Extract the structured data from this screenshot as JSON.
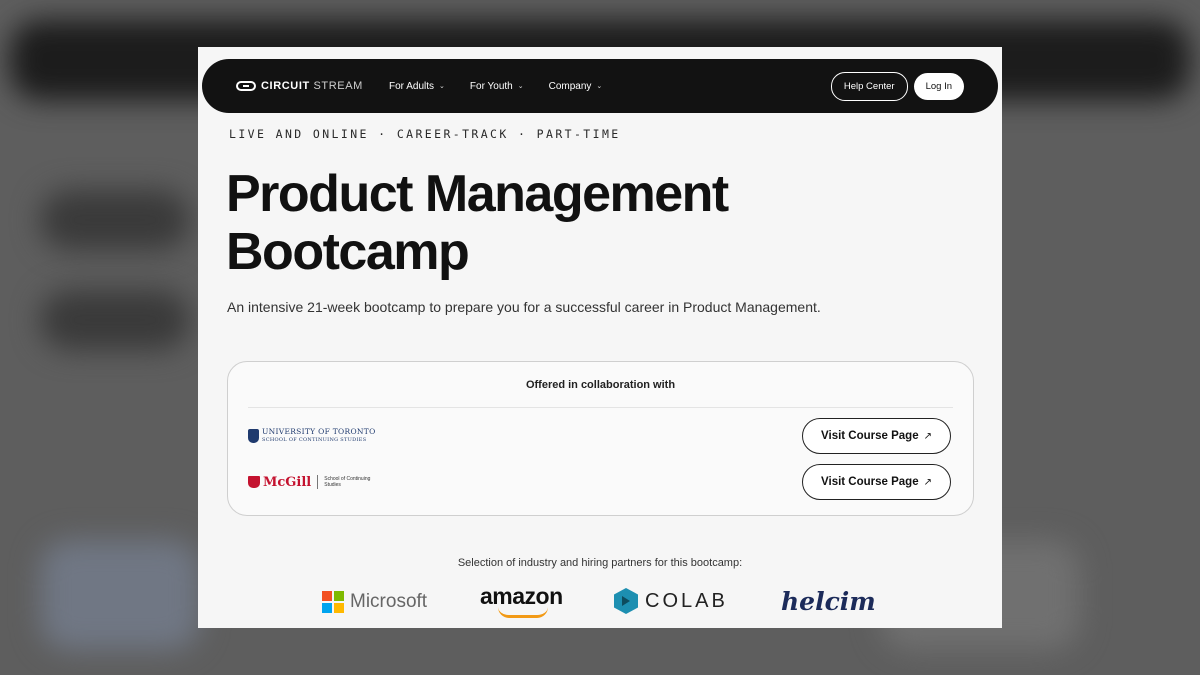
{
  "nav": {
    "logo_bold": "CIRCUIT",
    "logo_light": "STREAM",
    "items": [
      {
        "label": "For Adults"
      },
      {
        "label": "For Youth"
      },
      {
        "label": "Company"
      }
    ],
    "help_label": "Help Center",
    "login_label": "Log In"
  },
  "hero": {
    "eyebrow": "LIVE AND ONLINE · CAREER-TRACK · PART-TIME",
    "title_line1": "Product Management",
    "title_line2": "Bootcamp",
    "subtitle": "An intensive 21-week bootcamp to prepare you for a successful career in Product Management."
  },
  "collab": {
    "heading": "Offered in collaboration with",
    "uoft": {
      "line1": "UNIVERSITY OF TORONTO",
      "line2": "SCHOOL OF CONTINUING STUDIES"
    },
    "mcgill": {
      "name": "McGill",
      "sub": "School of Continuing Studies"
    },
    "visit_label": "Visit Course Page",
    "visit_arrow": "↗"
  },
  "partners": {
    "label": "Selection of industry and hiring partners for this bootcamp:",
    "microsoft": "Microsoft",
    "amazon": "amazon",
    "colab": "COLAB",
    "helcim": "helcim"
  },
  "colors": {
    "nav_bg": "#121212",
    "ms_red": "#f25022",
    "ms_green": "#7fba00",
    "ms_blue": "#00a4ef",
    "ms_yellow": "#ffb900",
    "amazon_orange": "#f29a16",
    "colab_teal": "#1d8fb1",
    "helcim_navy": "#1c2b5a"
  }
}
